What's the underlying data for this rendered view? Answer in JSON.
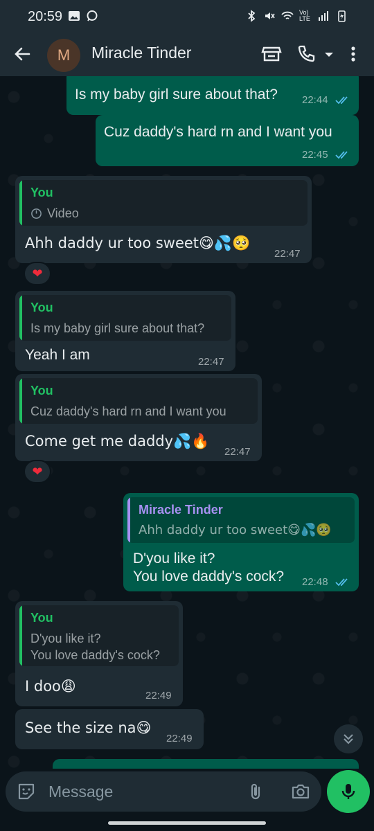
{
  "status_bar": {
    "time": "20:59",
    "volte": "Vo)\nLTE"
  },
  "header": {
    "avatar_letter": "M",
    "contact_name": "Miracle Tinder"
  },
  "messages": [
    {
      "text": "Is my baby girl sure about that?",
      "time": "22:44"
    },
    {
      "text": "Cuz daddy's hard rn and I want you",
      "time": "22:45"
    },
    {
      "quote_author": "You",
      "quote_text": "Video",
      "text": "Ahh daddy ur too sweet😋💦🥺",
      "time": "22:47",
      "reaction": "❤"
    },
    {
      "quote_author": "You",
      "quote_text": "Is my baby girl sure about that?",
      "text": "Yeah I am",
      "time": "22:47"
    },
    {
      "quote_author": "You",
      "quote_text": "Cuz daddy's hard rn and I want you",
      "text": "Come get me daddy💦🔥",
      "time": "22:47",
      "reaction": "❤"
    },
    {
      "quote_author": "Miracle Tinder",
      "quote_text": "Ahh daddy ur too sweet😋💦🥺",
      "text_line1": "D'you like it?",
      "text_line2": "You love daddy's cock?",
      "time": "22:48"
    },
    {
      "quote_author": "You",
      "quote_text_line1": "D'you like it?",
      "quote_text_line2": "You love daddy's cock?",
      "text": "I doo😩",
      "time": "22:49"
    },
    {
      "text": "See the size na😋",
      "time": "22:49"
    }
  ],
  "composer": {
    "placeholder": "Message"
  },
  "colors": {
    "outgoing": "#005c4b",
    "incoming": "#1f2c34",
    "accent": "#21c063",
    "read_tick": "#53bdeb",
    "quote_you": "#21c063",
    "quote_other": "#a791f2"
  },
  "icons": [
    "back-arrow-icon",
    "store-icon",
    "phone-icon",
    "dropdown-icon",
    "more-vert-icon",
    "emoji-sticker-icon",
    "attach-icon",
    "camera-icon",
    "mic-icon",
    "double-chevron-down-icon"
  ]
}
